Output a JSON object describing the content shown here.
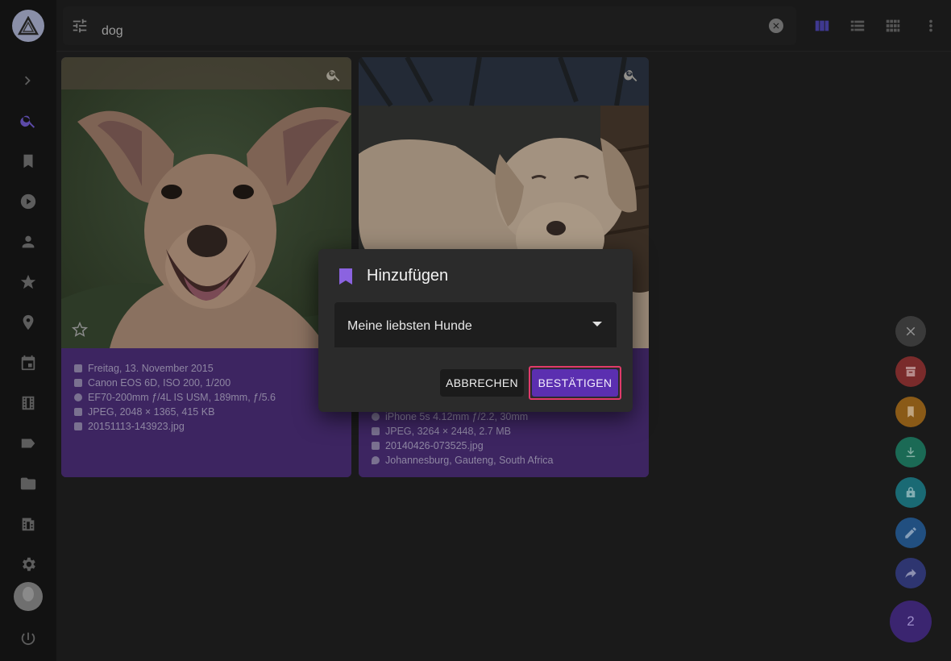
{
  "search": {
    "query": "dog"
  },
  "sidebar": {
    "items": [
      {
        "icon": "chevron-right-icon"
      },
      {
        "icon": "search-icon",
        "active": true
      },
      {
        "icon": "bookmark-icon"
      },
      {
        "icon": "play-circle-icon"
      },
      {
        "icon": "person-icon"
      },
      {
        "icon": "star-icon"
      },
      {
        "icon": "location-pin-icon"
      },
      {
        "icon": "calendar-icon"
      },
      {
        "icon": "film-icon"
      },
      {
        "icon": "label-icon"
      },
      {
        "icon": "folder-icon"
      },
      {
        "icon": "film-folder-icon"
      },
      {
        "icon": "gear-icon"
      },
      {
        "icon": "power-icon"
      }
    ]
  },
  "toolbar": {
    "view_modes": [
      "cards-view-icon",
      "list-view-icon",
      "mosaic-view-icon"
    ],
    "more_icon": "more-vert-icon"
  },
  "photos": [
    {
      "date": "Freitag, 13. November 2015",
      "camera": "Canon EOS 6D, ISO 200, 1/200",
      "lens": "EF70-200mm ƒ/4L IS USM, 189mm, ƒ/5.6",
      "file_info": "JPEG, 2048 × 1365, 415 KB",
      "filename": "20151113-143923.jpg"
    },
    {
      "lens": "iPhone 5s 4.12mm ƒ/2.2, 30mm",
      "file_info": "JPEG, 3264 × 2448, 2.7 MB",
      "filename": "20140426-073525.jpg",
      "location": "Johannesburg, Gauteng, South Africa"
    }
  ],
  "dialog": {
    "title": "Hinzufügen",
    "select_value": "Meine liebsten Hunde",
    "cancel_label": "ABBRECHEN",
    "confirm_label": "BESTÄTIGEN"
  },
  "fabs": {
    "colors": {
      "close": "#3a3a3a",
      "archive": "#7a2b2b",
      "bookmark": "#8a5a17",
      "download": "#1b6a55",
      "lock": "#1a6a74",
      "edit": "#214f80",
      "share": "#2e3570"
    },
    "selection_count": "2"
  },
  "colors": {
    "accent": "#5b2fb0",
    "focus_outline": "#e03a6a",
    "card_info_bg": "#3d2561"
  }
}
